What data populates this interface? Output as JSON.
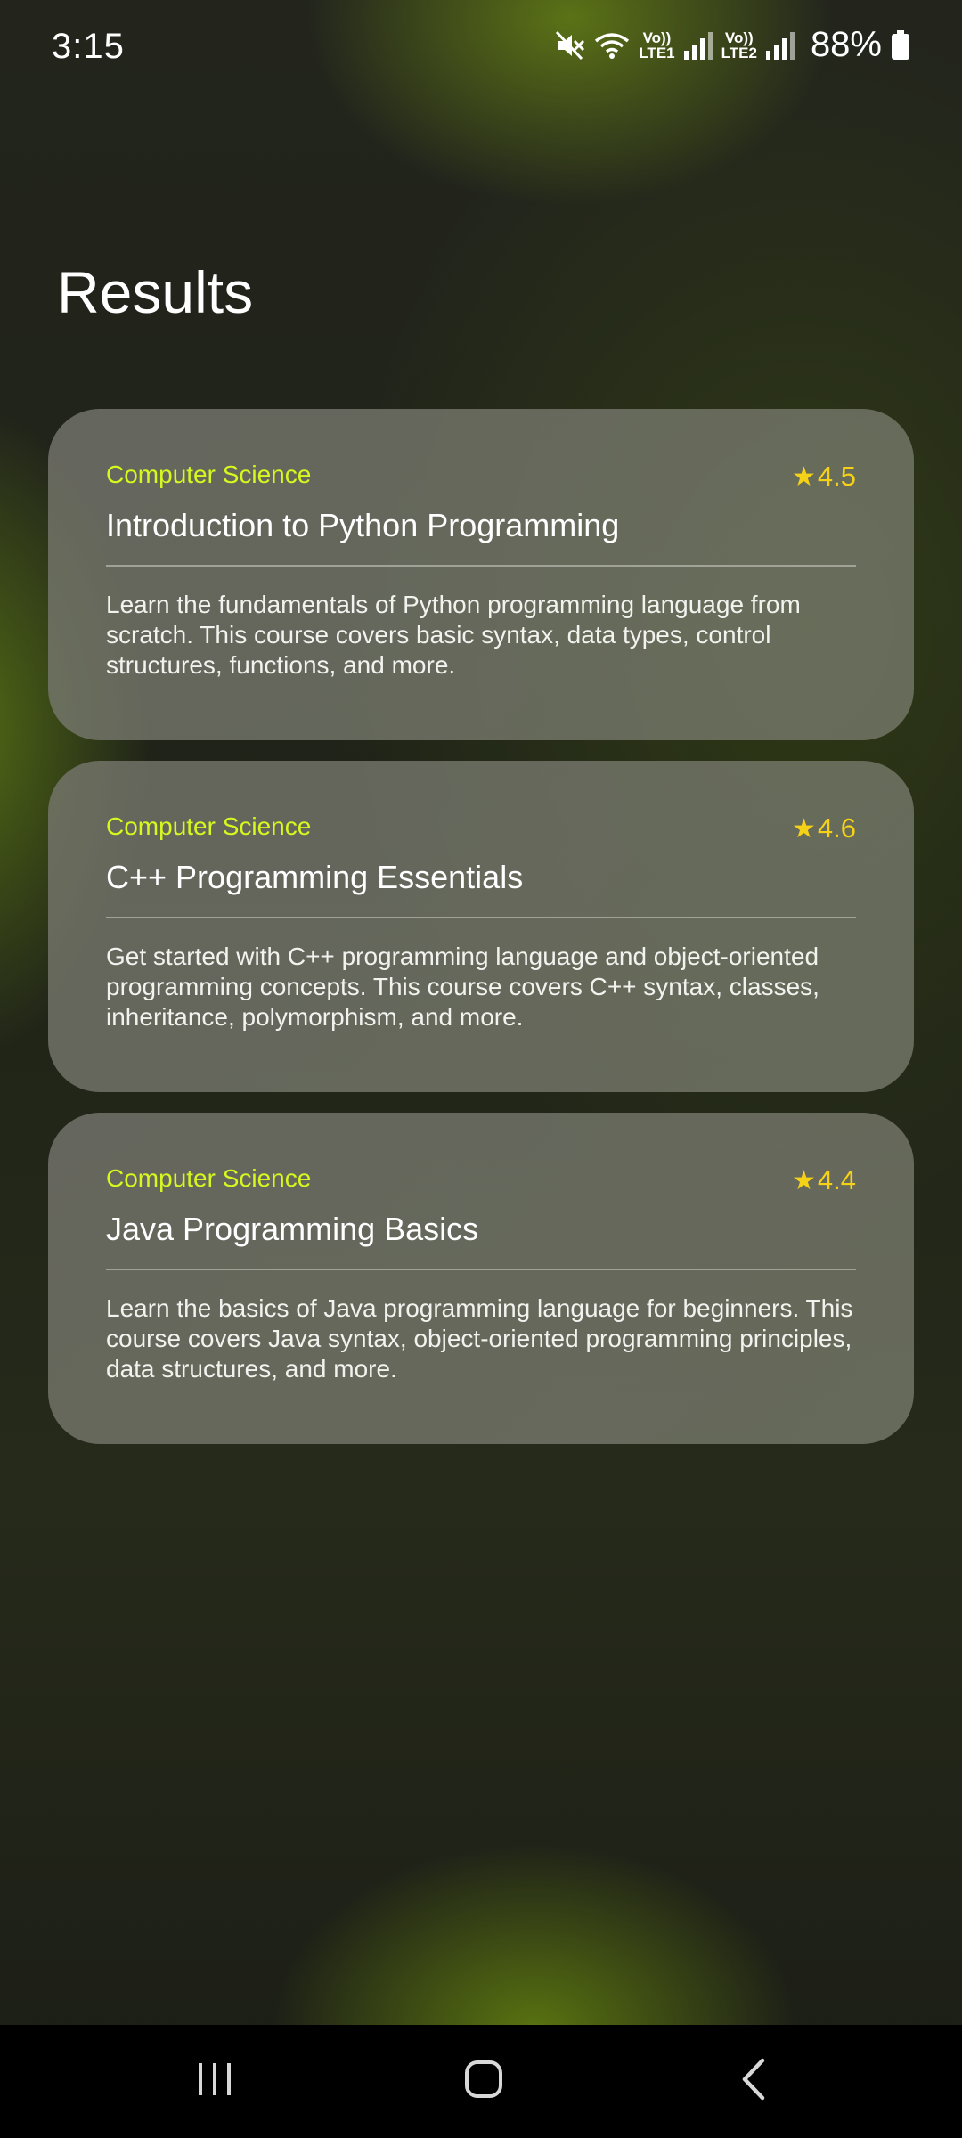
{
  "status_bar": {
    "time": "3:15",
    "lte1_top": "Vo))",
    "lte1_bottom": "LTE1",
    "lte2_top": "Vo))",
    "lte2_bottom": "LTE2",
    "battery_percent": "88%",
    "icons": [
      "mute-icon",
      "wifi-icon",
      "signal-icon",
      "battery-icon"
    ]
  },
  "page": {
    "title": "Results"
  },
  "results": [
    {
      "category": "Computer Science",
      "rating": "4.5",
      "title": "Introduction to Python Programming",
      "description": "Learn the fundamentals of Python programming language from scratch. This course covers basic syntax, data types, control structures, functions, and more."
    },
    {
      "category": "Computer Science",
      "rating": "4.6",
      "title": "C++ Programming Essentials",
      "description": "Get started with C++ programming language and object-oriented programming concepts. This course covers C++ syntax, classes, inheritance, polymorphism, and more."
    },
    {
      "category": "Computer Science",
      "rating": "4.4",
      "title": "Java Programming Basics",
      "description": "Learn the basics of Java programming language for beginners. This course covers Java syntax, object-oriented programming principles, data structures, and more."
    }
  ],
  "rating_star": "★",
  "colors": {
    "category": "#d6f71f",
    "rating": "#f5d217",
    "card_bg": "#777770"
  },
  "nav_bar": {
    "icons": [
      "recent-apps-icon",
      "home-icon",
      "back-icon"
    ]
  }
}
